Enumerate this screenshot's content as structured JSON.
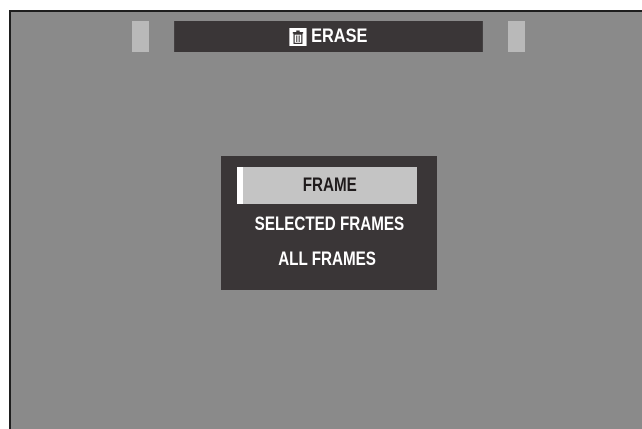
{
  "header": {
    "title": "ERASE",
    "icon": "trash-icon"
  },
  "menu": {
    "items": [
      {
        "label": "FRAME",
        "selected": true
      },
      {
        "label": "SELECTED FRAMES",
        "selected": false
      },
      {
        "label": "ALL FRAMES",
        "selected": false
      }
    ]
  },
  "colors": {
    "background": "#8a8a8a",
    "bar": "#3a3637",
    "highlight": "#c4c4c4",
    "cap": "#b9b9b9",
    "text": "#ffffff"
  }
}
